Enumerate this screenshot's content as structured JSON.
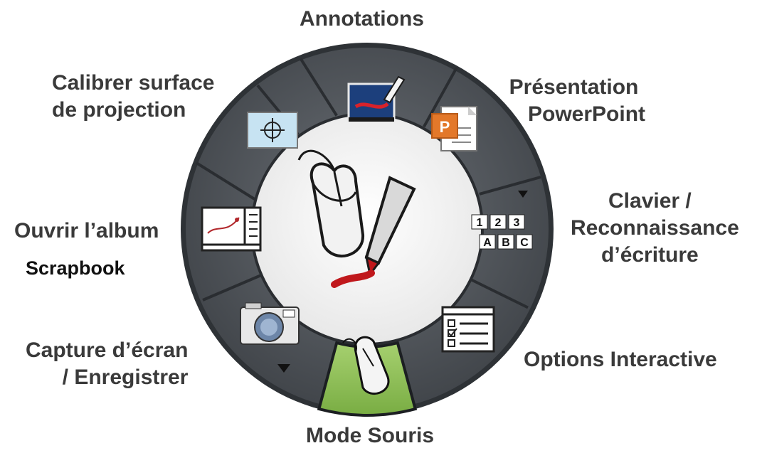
{
  "labels": {
    "annotations": "Annotations",
    "presentation": [
      "Présentation",
      "PowerPoint"
    ],
    "clavier": [
      "Clavier /",
      "Reconnaissance",
      "d’écriture"
    ],
    "options": "Options Interactive",
    "mode": "Mode Souris",
    "capture": [
      "Capture d’écran",
      "/ Enregistrer"
    ],
    "album": "Ouvrir l’album",
    "scrapbook": "Scrapbook",
    "calibrer": [
      "Calibrer surface",
      "de projection"
    ]
  },
  "keyboard_icon": {
    "top": [
      "1",
      "2",
      "3"
    ],
    "bottom": [
      "A",
      "B",
      "C"
    ]
  },
  "colors": {
    "ring": "#55595f",
    "ring_dark": "#3c4045",
    "selected": "#8cbf56",
    "center": "#ffffff",
    "label": "#3a3a3a"
  },
  "selected_tool": "Mode Souris"
}
